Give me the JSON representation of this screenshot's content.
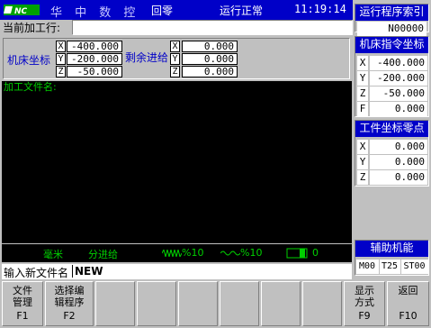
{
  "topbar": {
    "brand": "华 中 数 控",
    "mode": "回零",
    "status": "运行正常",
    "clock": "11:19:14"
  },
  "current_line": {
    "label": "当前加工行:",
    "value": ""
  },
  "machine_coords": {
    "label": "机床坐标",
    "axes": [
      {
        "axis": "X",
        "value": "-400.000"
      },
      {
        "axis": "Y",
        "value": "-200.000"
      },
      {
        "axis": "Z",
        "value": "-50.000"
      }
    ]
  },
  "remaining": {
    "label": "剩余进给",
    "axes": [
      {
        "axis": "X",
        "value": "0.000"
      },
      {
        "axis": "Y",
        "value": "0.000"
      },
      {
        "axis": "Z",
        "value": "0.000"
      }
    ]
  },
  "program": {
    "title": "加工文件名:"
  },
  "statusline": {
    "unit": "毫米",
    "feed_mode": "分进给",
    "feed_override_icon": "wave-icon",
    "feed_override": "%10",
    "spindle_override_icon": "spindle-wave-icon",
    "spindle_override": "%10",
    "rapid_value": "0"
  },
  "input": {
    "label": "输入新文件名",
    "value": "NEW"
  },
  "right_panel": {
    "prog_index_title": "运行程序索引",
    "prog_index_value": "N00000",
    "cmd_title": "机床指令坐标",
    "cmd_axes": [
      {
        "axis": "X",
        "value": "-400.000"
      },
      {
        "axis": "Y",
        "value": "-200.000"
      },
      {
        "axis": "Z",
        "value": "-50.000"
      },
      {
        "axis": "F",
        "value": "0.000"
      }
    ],
    "work_zero_title": "工件坐标零点",
    "work_axes": [
      {
        "axis": "X",
        "value": "0.000"
      },
      {
        "axis": "Y",
        "value": "0.000"
      },
      {
        "axis": "Z",
        "value": "0.000"
      }
    ],
    "aux_title": "辅助机能",
    "aux": [
      "M00",
      "T25",
      "ST00"
    ]
  },
  "fkeys": [
    {
      "label": "文件\n管理",
      "key": "F1"
    },
    {
      "label": "选择编\n辑程序",
      "key": "F2"
    },
    {
      "label": "",
      "key": ""
    },
    {
      "label": "",
      "key": ""
    },
    {
      "label": "",
      "key": ""
    },
    {
      "label": "",
      "key": ""
    },
    {
      "label": "",
      "key": ""
    },
    {
      "label": "",
      "key": ""
    },
    {
      "label": "显示\n方式",
      "key": "F9"
    },
    {
      "label": "返回",
      "key": "F10"
    }
  ],
  "colors": {
    "title_blue": "#0000c8",
    "screen_black": "#000000",
    "status_green": "#00d000",
    "panel_gray": "#c0c0c0"
  }
}
